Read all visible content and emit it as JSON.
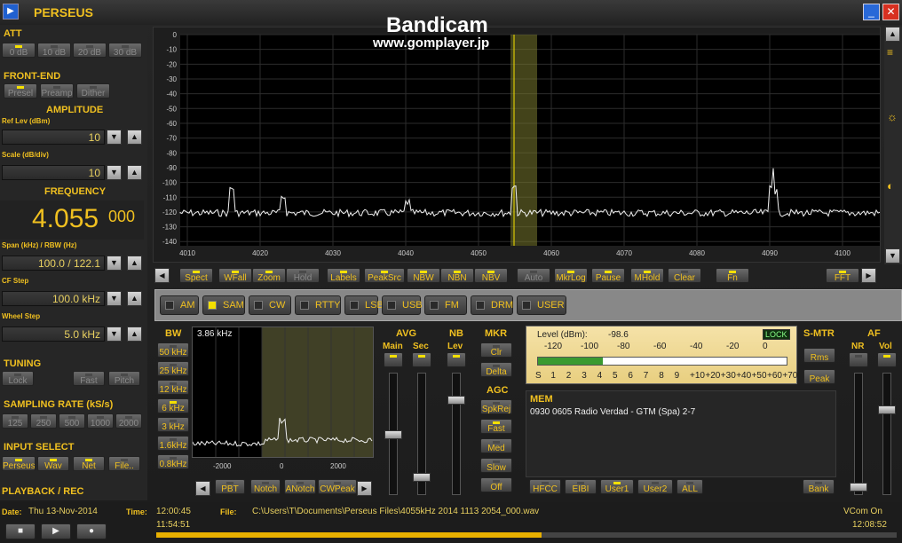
{
  "app": {
    "title": "PERSEUS",
    "watermark1": "Bandicam",
    "watermark2": "www.gomplayer.jp"
  },
  "sections": {
    "att": "ATT",
    "frontend": "FRONT-END",
    "amplitude": "AMPLITUDE",
    "frequency": "FREQUENCY",
    "tuning": "TUNING",
    "sampling": "SAMPLING RATE (kS/s)",
    "input": "INPUT SELECT",
    "playback": "PLAYBACK / REC"
  },
  "att": {
    "buttons": [
      "0 dB",
      "10 dB",
      "20 dB",
      "30 dB"
    ]
  },
  "frontend": {
    "buttons": [
      "Presel",
      "Preamp",
      "Dither"
    ]
  },
  "amplitude": {
    "ref_label": "Ref Lev (dBm)",
    "ref_value": "10",
    "scale_label": "Scale (dB/div)",
    "scale_value": "10"
  },
  "frequency": {
    "main": "4.055",
    "sub": "000",
    "span_label": "Span (kHz) / RBW (Hz)",
    "span_value": "100.0 / 122.1",
    "cf_label": "CF Step",
    "cf_value": "100.0 kHz",
    "wheel_label": "Wheel Step",
    "wheel_value": "5.0 kHz"
  },
  "tuning": {
    "buttons": [
      "Lock",
      "Fast",
      "Pitch"
    ]
  },
  "sampling": {
    "buttons": [
      "125",
      "250",
      "500",
      "1000",
      "2000"
    ]
  },
  "input": {
    "buttons": [
      "Perseus",
      "Wav",
      "Net",
      "File.."
    ]
  },
  "spectrum": {
    "y_ticks": [
      "0",
      "-10",
      "-20",
      "-30",
      "-40",
      "-50",
      "-60",
      "-70",
      "-80",
      "-90",
      "-100",
      "-110",
      "-120",
      "-130",
      "-140"
    ],
    "x_ticks": [
      "4010",
      "4020",
      "4030",
      "4040",
      "4050",
      "4060",
      "4070",
      "4080",
      "4090",
      "4100"
    ]
  },
  "toolbar": {
    "buttons": [
      "Spect",
      "WFall",
      "Zoom",
      "Hold",
      "Labels",
      "PeakSrc",
      "NBW",
      "NBN",
      "NBV",
      "Auto",
      "MkrLog",
      "Pause",
      "MHold",
      "Clear",
      "Fn",
      "FFT"
    ]
  },
  "modes": [
    "AM",
    "SAM",
    "CW",
    "RTTY",
    "LSB",
    "USB",
    "FM",
    "DRM",
    "USER"
  ],
  "bw": {
    "header": "BW",
    "value": "3.86 kHz",
    "buttons": [
      "50 kHz",
      "25 kHz",
      "12 kHz",
      "6 kHz",
      "3 kHz",
      "1.6kHz",
      "0.8kHz"
    ],
    "x_ticks": [
      "-2000",
      "0",
      "2000"
    ],
    "bottom_buttons": [
      "PBT",
      "Notch",
      "ANotch",
      "CWPeak"
    ]
  },
  "avg": {
    "header": "AVG",
    "main": "Main",
    "sec": "Sec"
  },
  "nb": {
    "header": "NB",
    "lev": "Lev"
  },
  "mkr": {
    "header": "MKR",
    "buttons": [
      "Clr",
      "Delta"
    ]
  },
  "agc": {
    "header": "AGC",
    "buttons": [
      "SpkRej",
      "Fast",
      "Med",
      "Slow",
      "Off"
    ]
  },
  "level": {
    "label": "Level (dBm):",
    "value": "-98.6",
    "lock": "LOCK",
    "scale_top": [
      "-120",
      "-100",
      "-80",
      "-60",
      "-40",
      "-20",
      "0"
    ],
    "scale_bottom": [
      "S",
      "1",
      "2",
      "3",
      "4",
      "5",
      "6",
      "7",
      "8",
      "9",
      "+10",
      "+20",
      "+30",
      "+40",
      "+50",
      "+60",
      "+70"
    ],
    "fill": 0.26
  },
  "smtr": {
    "header": "S-MTR",
    "buttons": [
      "Rms",
      "Peak"
    ]
  },
  "af": {
    "header": "AF",
    "nr": "NR",
    "vol": "Vol"
  },
  "mem": {
    "header": "MEM",
    "entry": "0930 0605 Radio Verdad  - GTM (Spa)  2-7",
    "buttons": [
      "HFCC",
      "EIBI",
      "User1",
      "User2",
      "ALL",
      "Bank"
    ]
  },
  "status": {
    "date_label": "Date:",
    "date": "Thu 13-Nov-2014",
    "time_label": "Time:",
    "time": "12:00:45",
    "file_label": "File:",
    "file": "C:\\Users\\T\\Documents\\Perseus Files\\4055kHz 2014 1113 2054_000.wav",
    "vcom": "VCom On",
    "start": "11:54:51",
    "end": "12:08:52",
    "progress": 0.52
  }
}
